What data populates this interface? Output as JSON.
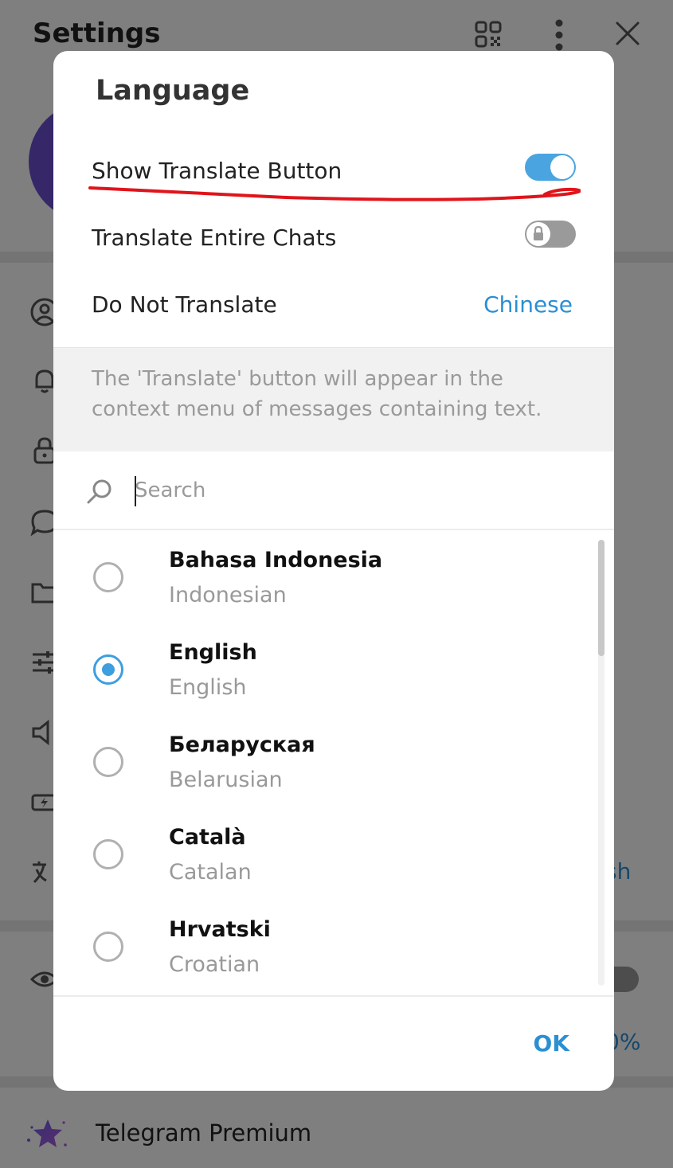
{
  "background": {
    "title": "Settings",
    "language_value_partial": "sh",
    "scale_value_partial": "0%",
    "premium_label": "Telegram Premium",
    "icons": [
      "qr-code-icon",
      "more-vertical-icon",
      "close-icon",
      "profile-icon",
      "bell-icon",
      "lock-icon",
      "chat-icon",
      "folder-icon",
      "sliders-icon",
      "speaker-icon",
      "battery-icon",
      "translate-icon",
      "eye-icon",
      "premium-star-icon"
    ]
  },
  "dialog": {
    "title": "Language",
    "show_translate": {
      "label": "Show Translate Button",
      "enabled": true
    },
    "translate_chats": {
      "label": "Translate Entire Chats",
      "enabled": false,
      "locked": true
    },
    "do_not_translate": {
      "label": "Do Not Translate",
      "value": "Chinese"
    },
    "info_text": "The 'Translate' button will appear in the context menu of messages containing text.",
    "search": {
      "placeholder": "Search",
      "value": ""
    },
    "languages": [
      {
        "native": "Bahasa Indonesia",
        "english": "Indonesian",
        "selected": false
      },
      {
        "native": "English",
        "english": "English",
        "selected": true
      },
      {
        "native": "Беларуская",
        "english": "Belarusian",
        "selected": false
      },
      {
        "native": "Català",
        "english": "Catalan",
        "selected": false
      },
      {
        "native": "Hrvatski",
        "english": "Croatian",
        "selected": false
      }
    ],
    "ok_label": "OK"
  },
  "colors": {
    "accent": "#2b8fd3",
    "annotation": "#e0141b",
    "avatar": "#6a4fd0"
  }
}
